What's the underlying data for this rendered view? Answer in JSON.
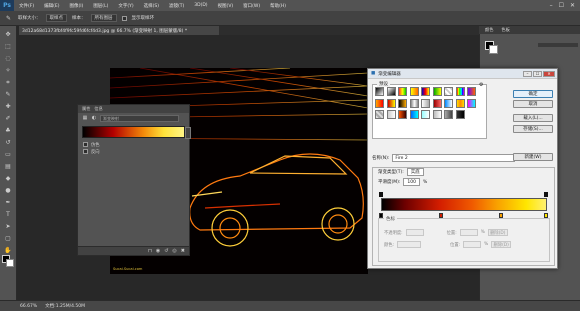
{
  "app": {
    "logo": "Ps"
  },
  "menubar": {
    "items": [
      "文件(F)",
      "编辑(E)",
      "图像(I)",
      "图层(L)",
      "文字(Y)",
      "选择(S)",
      "滤镜(T)",
      "3D(D)",
      "视图(V)",
      "窗口(W)",
      "帮助(H)"
    ],
    "window_controls": [
      "–",
      "☐",
      "✕"
    ]
  },
  "optionsbar": {
    "sample_size_label": "取样大小：",
    "sample_size_value": "取样点",
    "sample_label": "样本：",
    "sample_value": "所有图层",
    "show_ring_label": "显示取样环"
  },
  "document": {
    "tab_title": "3d12a68d1373fbf4f9fc59fd6fcf4d3.jpg @ 66.7% (渐变映射 1, 图层蒙版/8) *",
    "watermark": "Sucai.Sucai.com"
  },
  "right_panel": {
    "tabs": [
      "颜色",
      "色板"
    ]
  },
  "statusbar": {
    "zoom": "66.67%",
    "doc_size": "文档:1.25M/4.50M"
  },
  "properties": {
    "tabs": [
      "属性",
      "信息"
    ],
    "title_placeholder": "渐变映射",
    "options": [
      "仿色",
      "反向"
    ]
  },
  "gradient_editor": {
    "title": "渐变编辑器",
    "presets_label": "预设",
    "buttons": {
      "ok": "确定",
      "cancel": "取消",
      "load": "载入(L)...",
      "save": "存储(S)...",
      "new": "新建(W)"
    },
    "name_label": "名称(N):",
    "name_value": "Fire 2",
    "type_label": "渐变类型(T):",
    "type_value": "实底",
    "smoothness_label": "平滑度(M):",
    "smoothness_value": "100",
    "smoothness_unit": "%",
    "stops_label": "色标",
    "opacity_label": "不透明度:",
    "location_label": "位置:",
    "color_label": "颜色:",
    "delete_label": "删除(D)",
    "location_unit": "%"
  },
  "colors": {
    "presets": [
      "#222",
      "#fff",
      "#e33",
      "#f90",
      "#00c",
      "#6c6",
      "#ccc",
      "#ff0",
      "#a0f",
      "#fa0",
      "#f60",
      "#000",
      "#888",
      "#fff",
      "#c00",
      "#09f",
      "#fd0",
      "#f0f",
      "#ddd",
      "#ccc",
      "#f50",
      "#06f",
      "#9ff",
      "#bbb",
      "#aaa",
      "#333"
    ]
  }
}
